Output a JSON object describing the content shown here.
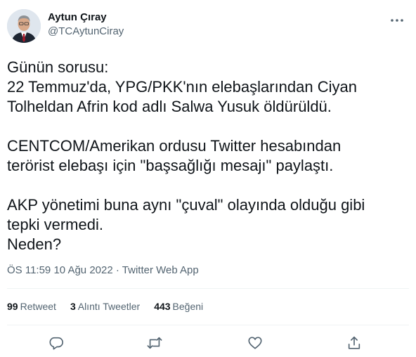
{
  "author": {
    "display_name": "Aytun Çıray",
    "handle": "@TCAytunCiray"
  },
  "tweet": {
    "text": "Günün sorusu:\n22 Temmuz'da, YPG/PKK'nın elebaşlarından Ciyan\nTolheldan Afrin kod adlı Salwa Yusuk öldürüldü.\n\nCENTCOM/Amerikan ordusu Twitter hesabından\nterörist elebaşı için \"başsağlığı mesajı\" paylaştı.\n\nAKP yönetimi buna aynı \"çuval\" olayında olduğu gibi\ntepki vermedi.\nNeden?",
    "time": "ÖS 11:59",
    "date": "10 Ağu 2022",
    "source": "Twitter Web App",
    "separator": "·"
  },
  "stats": {
    "retweets_count": "99",
    "retweets_label": "Retweet",
    "quotes_count": "3",
    "quotes_label": "Alıntı Tweetler",
    "likes_count": "443",
    "likes_label": "Beğeni"
  },
  "icons": {
    "more": "more-dots-icon",
    "reply": "reply-icon",
    "retweet": "retweet-icon",
    "like": "heart-icon",
    "share": "share-icon"
  },
  "colors": {
    "text_primary": "#0f1419",
    "text_secondary": "#536471",
    "divider": "#eff3f4"
  }
}
